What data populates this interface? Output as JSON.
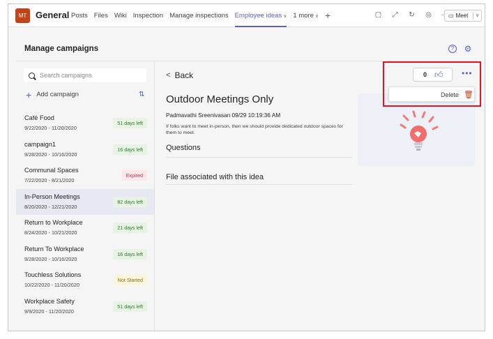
{
  "header": {
    "avatar_initials": "MT",
    "team_name": "General",
    "tabs": [
      {
        "label": "Posts"
      },
      {
        "label": "Files"
      },
      {
        "label": "Wiki"
      },
      {
        "label": "Inspection"
      },
      {
        "label": "Manage inspections"
      },
      {
        "label": "Employee ideas",
        "active": true
      },
      {
        "label": "1 more"
      }
    ],
    "add_tab": "+",
    "meet_label": "Meet",
    "icons": [
      "chat-icon",
      "expand-icon",
      "refresh-icon",
      "globe-icon",
      "more-icon"
    ]
  },
  "page": {
    "title": "Manage campaigns"
  },
  "sidebar": {
    "search_placeholder": "Search campaigns",
    "add_label": "Add campaign",
    "campaigns": [
      {
        "name": "Café Food",
        "dates": "9/22/2020 - 11/20/2020",
        "status": "51 days left",
        "tone": "green"
      },
      {
        "name": "campaign1",
        "dates": "9/28/2020 - 10/16/2020",
        "status": "16 days left",
        "tone": "green"
      },
      {
        "name": "Communal Spaces",
        "dates": "7/22/2020 - 8/21/2020",
        "status": "Expired",
        "tone": "red"
      },
      {
        "name": "In-Person Meetings",
        "dates": "8/20/2020 - 12/21/2020",
        "status": "82 days left",
        "tone": "green",
        "selected": true
      },
      {
        "name": "Return to Workplace",
        "dates": "8/24/2020 - 10/21/2020",
        "status": "21 days left",
        "tone": "green"
      },
      {
        "name": "Return To Workplace",
        "dates": "9/28/2020 - 10/16/2020",
        "status": "16 days left",
        "tone": "green"
      },
      {
        "name": "Touchless Solutions",
        "dates": "10/22/2020 - 11/20/2020",
        "status": "Not Started",
        "tone": "yellow"
      },
      {
        "name": "Workplace Safety",
        "dates": "9/9/2020 - 11/20/2020",
        "status": "51 days left",
        "tone": "green"
      }
    ]
  },
  "detail": {
    "back_label": "Back",
    "title": "Outdoor Meetings Only",
    "author_line": "Padmavathi Sreenivasan  09/29 10:19:36 AM",
    "description": "If folks want to meet in-person, then we should provide dedicated outdoor spaces for them to meet.",
    "questions_heading": "Questions",
    "files_heading": "File associated with this idea",
    "like_count": "0",
    "menu_delete_label": "Delete"
  },
  "colors": {
    "accent": "#5b5fc7",
    "avatar": "#c4441a",
    "highlight_box": "#e81123"
  }
}
